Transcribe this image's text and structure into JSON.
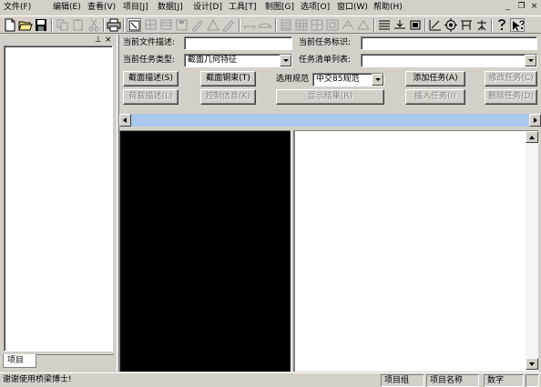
{
  "menu": {
    "items": [
      "文件(F)",
      "编辑(E)",
      "查看(V)",
      "项目[J]",
      "数据[J]",
      "设计[D]",
      "工具[T]",
      "制图[G]",
      "选项[O]",
      "窗口(W)",
      "帮助(H)"
    ],
    "win_minimize": "_",
    "win_restore": "❐",
    "win_close": "×"
  },
  "left_panel": {
    "tab_label": "项目",
    "pin": "⊥",
    "close": "×"
  },
  "form": {
    "doc_desc_label": "当前文件描述:",
    "doc_desc_value": "",
    "task_id_label": "当前任务标识:",
    "task_id_value": "",
    "task_type_label": "当前任务类型:",
    "task_type_value": "截面几何特征",
    "task_list_label": "任务清单列表:",
    "task_list_value": "",
    "code_label": "选用规范",
    "code_value": "中交85规范"
  },
  "buttons": {
    "section_desc": "截面描述(S)",
    "section_rebar": "截面钢束(T)",
    "add_task": "添加任务(A)",
    "modify_task": "修改任务(C)",
    "load_desc": "荷载描述(L)",
    "control_info": "控制信息(K)",
    "show_result": "显示结果(R)",
    "insert_task": "插入任务(I)",
    "delete_task": "删除任务(D)"
  },
  "status": {
    "message": "谢谢使用桥梁博士!",
    "project_group": "项目组",
    "project_name": "项目名称",
    "num_lock": "数字"
  },
  "colors": {
    "face": "#d4d0c8",
    "scroll_thumb": "#a8c8ec",
    "view_left_bg": "#000000",
    "view_right_bg": "#ffffff"
  }
}
